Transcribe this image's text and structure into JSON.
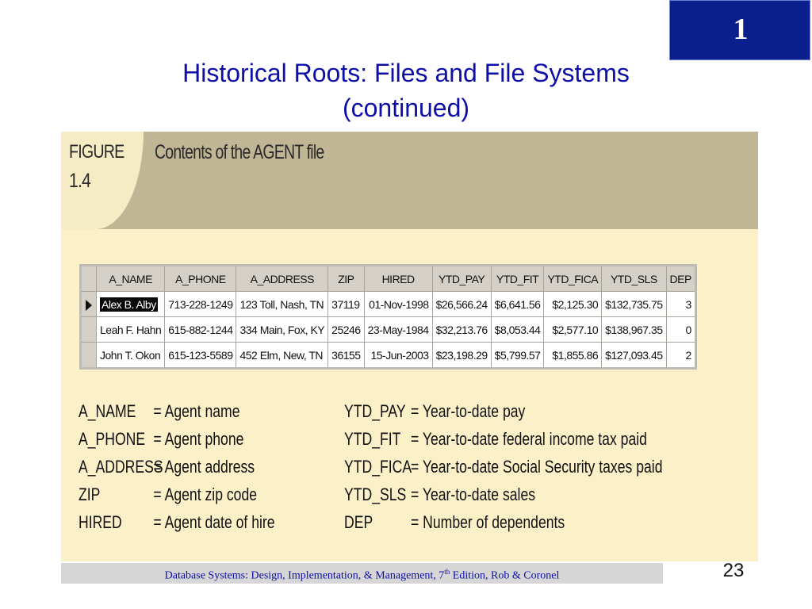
{
  "slide": {
    "chapter_number": "1",
    "title_line1": "Historical Roots: Files and File Systems",
    "title_line2": "(continued)",
    "page_number": "23"
  },
  "figure": {
    "word": "FIGURE",
    "number": "1.4",
    "caption": "Contents of the AGENT file",
    "columns": [
      "A_NAME",
      "A_PHONE",
      "A_ADDRESS",
      "ZIP",
      "HIRED",
      "YTD_PAY",
      "YTD_FIT",
      "YTD_FICA",
      "YTD_SLS",
      "DEP"
    ],
    "rows": [
      [
        "Alex B. Alby",
        "713-228-1249",
        "123 Toll, Nash, TN",
        "37119",
        "01-Nov-1998",
        "$26,566.24",
        "$6,641.56",
        "$2,125.30",
        "$132,735.75",
        "3"
      ],
      [
        "Leah F. Hahn",
        "615-882-1244",
        "334 Main, Fox, KY",
        "25246",
        "23-May-1984",
        "$32,213.76",
        "$8,053.44",
        "$2,577.10",
        "$138,967.35",
        "0"
      ],
      [
        "John T. Okon",
        "615-123-5589",
        "452 Elm, New, TN",
        "36155",
        "15-Jun-2003",
        "$23,198.29",
        "$5,799.57",
        "$1,855.86",
        "$127,093.45",
        "2"
      ]
    ],
    "legend_left": [
      {
        "code": "A_NAME",
        "desc": "= Agent name"
      },
      {
        "code": "A_PHONE",
        "desc": "= Agent phone"
      },
      {
        "code": "A_ADDRESS",
        "desc": "= Agent address"
      },
      {
        "code": "ZIP",
        "desc": "= Agent zip code"
      },
      {
        "code": "HIRED",
        "desc": "= Agent date of hire"
      }
    ],
    "legend_right": [
      {
        "code": "YTD_PAY",
        "desc": "= Year-to-date pay"
      },
      {
        "code": "YTD_FIT",
        "desc": "= Year-to-date federal income tax paid"
      },
      {
        "code": "YTD_FICA",
        "desc": "= Year-to-date Social Security taxes paid"
      },
      {
        "code": "YTD_SLS",
        "desc": "= Year-to-date sales"
      },
      {
        "code": "DEP",
        "desc": "= Number of dependents"
      }
    ]
  },
  "footer": {
    "text_before": "Database Systems: Design, Implementation, & Management, 7",
    "superscript": "th",
    "text_after": " Edition, Rob & Coronel"
  }
}
